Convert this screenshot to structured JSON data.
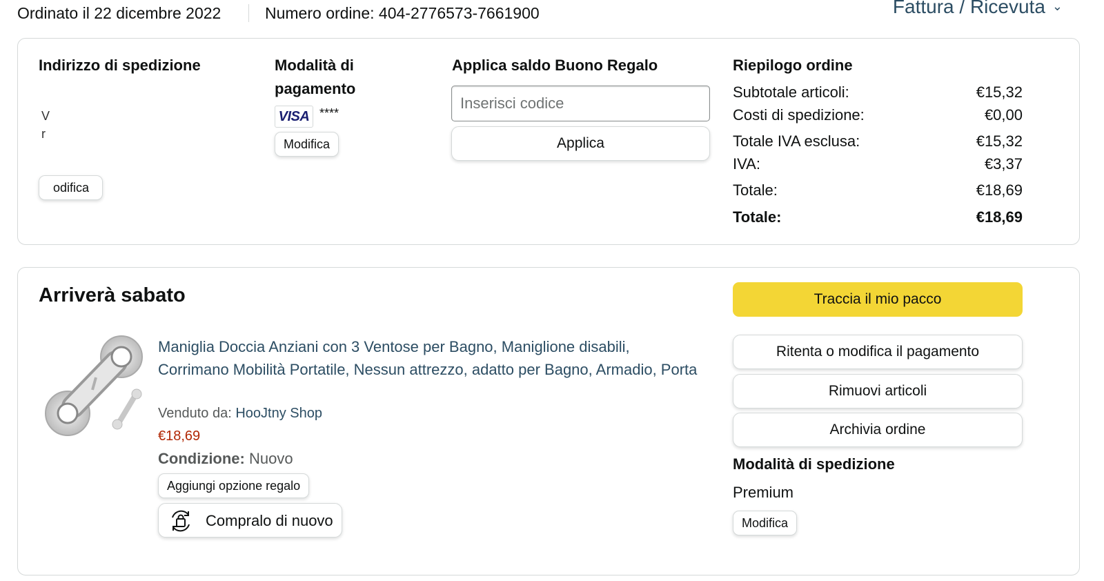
{
  "header": {
    "order_date": "Ordinato il 22 dicembre 2022",
    "order_number": "Numero ordine: 404-2776573-7661900",
    "invoice_link": "Fattura / Ricevuta",
    "invoice_icon": "chevron-down-icon"
  },
  "shipping_address": {
    "title": "Indirizzo di spedizione",
    "line1": "V",
    "line2": "r",
    "modify_button": "odifica"
  },
  "payment": {
    "title": "Modalità di pagamento",
    "card_brand": "VISA",
    "card_mask": "****",
    "modify_button": "Modifica"
  },
  "gift_card": {
    "title": "Applica saldo Buono Regalo",
    "placeholder": "Inserisci codice",
    "value": "",
    "apply_button": "Applica"
  },
  "summary": {
    "title": "Riepilogo ordine",
    "rows": [
      {
        "label": "Subtotale articoli:",
        "value": "€15,32"
      },
      {
        "label": "Costi di spedizione:",
        "value": "€0,00"
      },
      {
        "label": "Totale IVA esclusa:",
        "value": "€15,32"
      },
      {
        "label": "IVA:",
        "value": "€3,37"
      },
      {
        "label": "Totale:",
        "value": "€18,69"
      },
      {
        "label": "Totale:",
        "value": "€18,69"
      }
    ]
  },
  "delivery": {
    "title": "Arriverà sabato",
    "product_title": "Maniglia Doccia Anziani con 3 Ventose per Bagno, Maniglione disabili, Corrimano Mobilità Portatile, Nessun attrezzo, adatto per Bagno, Armadio, Porta",
    "sold_by_label": "Venduto da:",
    "seller": "HooJtny Shop",
    "price": "€18,69",
    "condition_label": "Condizione:",
    "condition_value": "Nuovo",
    "gift_button": "Aggiungi opzione regalo",
    "buy_again_button": "Compralo di nuovo",
    "buy_again_icon": "reorder-bag-icon"
  },
  "actions": {
    "track": "Traccia il mio pacco",
    "retry_payment": "Ritenta o modifica il pagamento",
    "remove_items": "Rimuovi articoli",
    "archive": "Archivia ordine"
  },
  "shipping_method": {
    "title": "Modalità di spedizione",
    "value": "Premium",
    "modify_button": "Modifica"
  },
  "colors": {
    "link": "#2c4d63",
    "price": "#b12704",
    "primary_button": "#f3d635",
    "border": "#d5d9d9"
  }
}
